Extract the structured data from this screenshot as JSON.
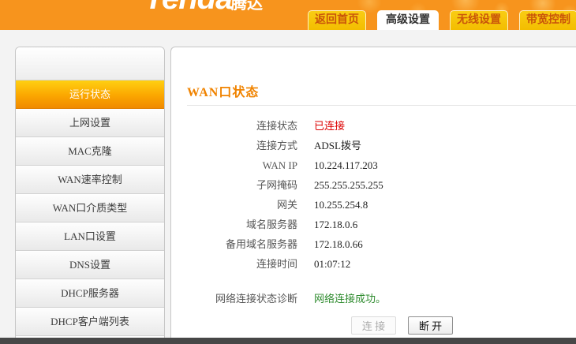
{
  "header": {
    "logo": {
      "brand": "Tenda",
      "brand_cn": "腾达"
    },
    "tabs": [
      {
        "label": "返回首页",
        "active": false
      },
      {
        "label": "高级设置",
        "active": true
      },
      {
        "label": "无线设置",
        "active": false
      },
      {
        "label": "带宽控制",
        "active": false
      }
    ]
  },
  "sidebar": {
    "items": [
      {
        "label": "运行状态",
        "active": true
      },
      {
        "label": "上网设置",
        "active": false
      },
      {
        "label": "MAC克隆",
        "active": false
      },
      {
        "label": "WAN速率控制",
        "active": false
      },
      {
        "label": "WAN口介质类型",
        "active": false
      },
      {
        "label": "LAN口设置",
        "active": false
      },
      {
        "label": "DNS设置",
        "active": false
      },
      {
        "label": "DHCP服务器",
        "active": false
      },
      {
        "label": "DHCP客户端列表",
        "active": false
      }
    ]
  },
  "main": {
    "title": "WAN口状态",
    "rows": [
      {
        "label": "连接状态",
        "value": "已连接",
        "value_color": "#dd0000"
      },
      {
        "label": "连接方式",
        "value": "ADSL拨号"
      },
      {
        "label": "WAN IP",
        "value": "10.224.117.203"
      },
      {
        "label": "子网掩码",
        "value": "255.255.255.255"
      },
      {
        "label": "网关",
        "value": "10.255.254.8"
      },
      {
        "label": "域名服务器",
        "value": "172.18.0.6"
      },
      {
        "label": "备用域名服务器",
        "value": "172.18.0.66"
      },
      {
        "label": "连接时间",
        "value": "01:07:12"
      },
      {
        "label": "网络连接状态诊断",
        "value": "网络连接成功。",
        "value_color": "#2e8b2e",
        "gap_before": true
      }
    ],
    "buttons": [
      {
        "label": "连 接",
        "disabled": true
      },
      {
        "label": "断 开",
        "disabled": false
      }
    ]
  },
  "colors": {
    "header_orange": "#f7941d",
    "tab_yellow": "#f3bd00",
    "active_item_orange": "#f59000",
    "title_orange": "#f08300",
    "status_red": "#dd0000",
    "status_green": "#2e8b2e"
  }
}
